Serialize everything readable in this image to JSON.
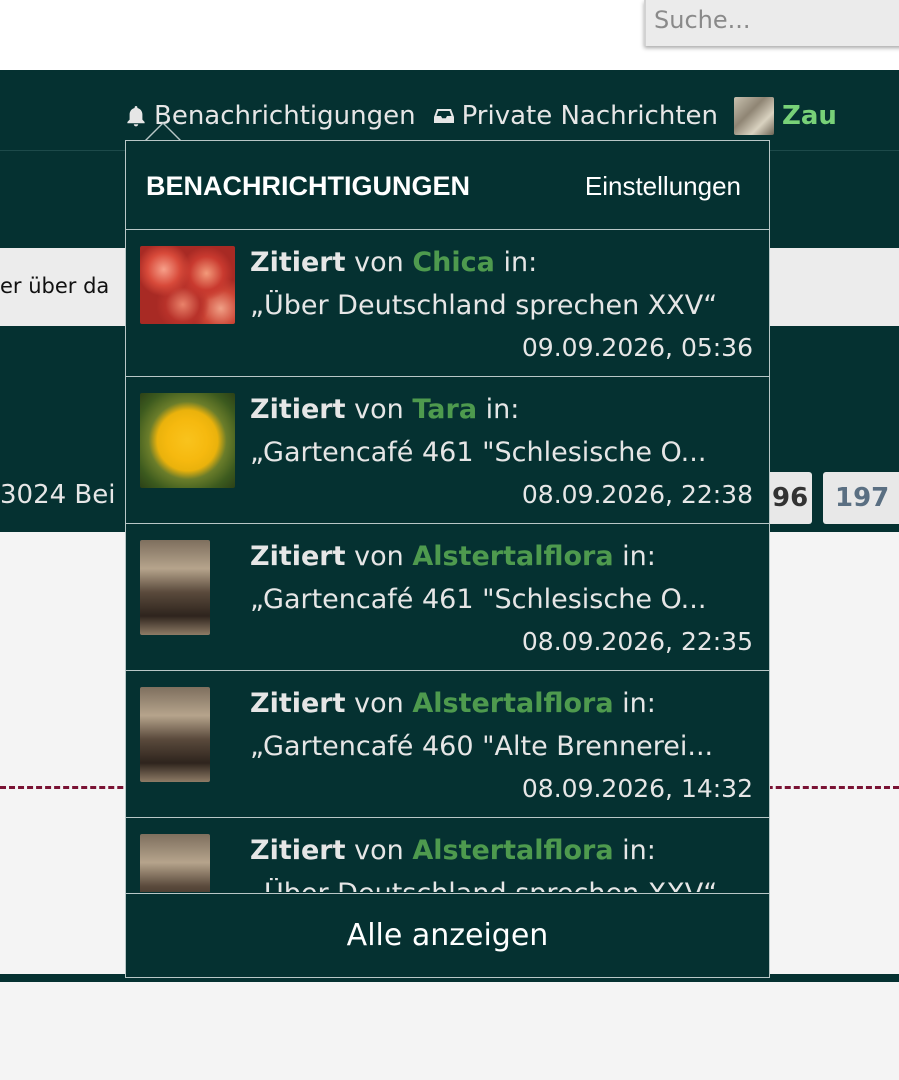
{
  "search": {
    "placeholder": "Suche..."
  },
  "nav": {
    "notifications_label": "Benachrichtigungen",
    "messages_label": "Private Nachrichten",
    "username": "Zau"
  },
  "background": {
    "notice_text": "er über da",
    "posts_text": "3024 Bei",
    "pages": [
      "96",
      "197"
    ]
  },
  "dropdown": {
    "title": "BENACHRICHTIGUNGEN",
    "settings_label": "Einstellungen",
    "show_all_label": "Alle anzeigen",
    "items": [
      {
        "action": "Zitiert",
        "from": "von",
        "user": "Chica",
        "in": "in:",
        "topic": "„Über Deutschland sprechen XXV“",
        "time": "09.09.2026, 05:36",
        "thumb": "plums-photo"
      },
      {
        "action": "Zitiert",
        "from": "von",
        "user": "Tara",
        "in": "in:",
        "topic": "„Gartencafé 461 \"Schlesische O...",
        "time": "08.09.2026, 22:38",
        "thumb": "dandelion-photo"
      },
      {
        "action": "Zitiert",
        "from": "von",
        "user": "Alstertalflora",
        "in": "in:",
        "topic": "„Gartencafé 461 \"Schlesische O...",
        "time": "08.09.2026, 22:35",
        "thumb": "portrait-photo"
      },
      {
        "action": "Zitiert",
        "from": "von",
        "user": "Alstertalflora",
        "in": "in:",
        "topic": "„Gartencafé 460 \"Alte Brennerei...",
        "time": "08.09.2026, 14:32",
        "thumb": "portrait-photo"
      },
      {
        "action": "Zitiert",
        "from": "von",
        "user": "Alstertalflora",
        "in": "in:",
        "topic": "„Über Deutschland sprechen XXV“",
        "time": "",
        "thumb": "portrait-photo"
      }
    ]
  },
  "colors": {
    "dark_teal": "#053131",
    "username_green": "#4e9a4e",
    "nav_user_green": "#78d178",
    "divider_red": "#7a1334"
  }
}
